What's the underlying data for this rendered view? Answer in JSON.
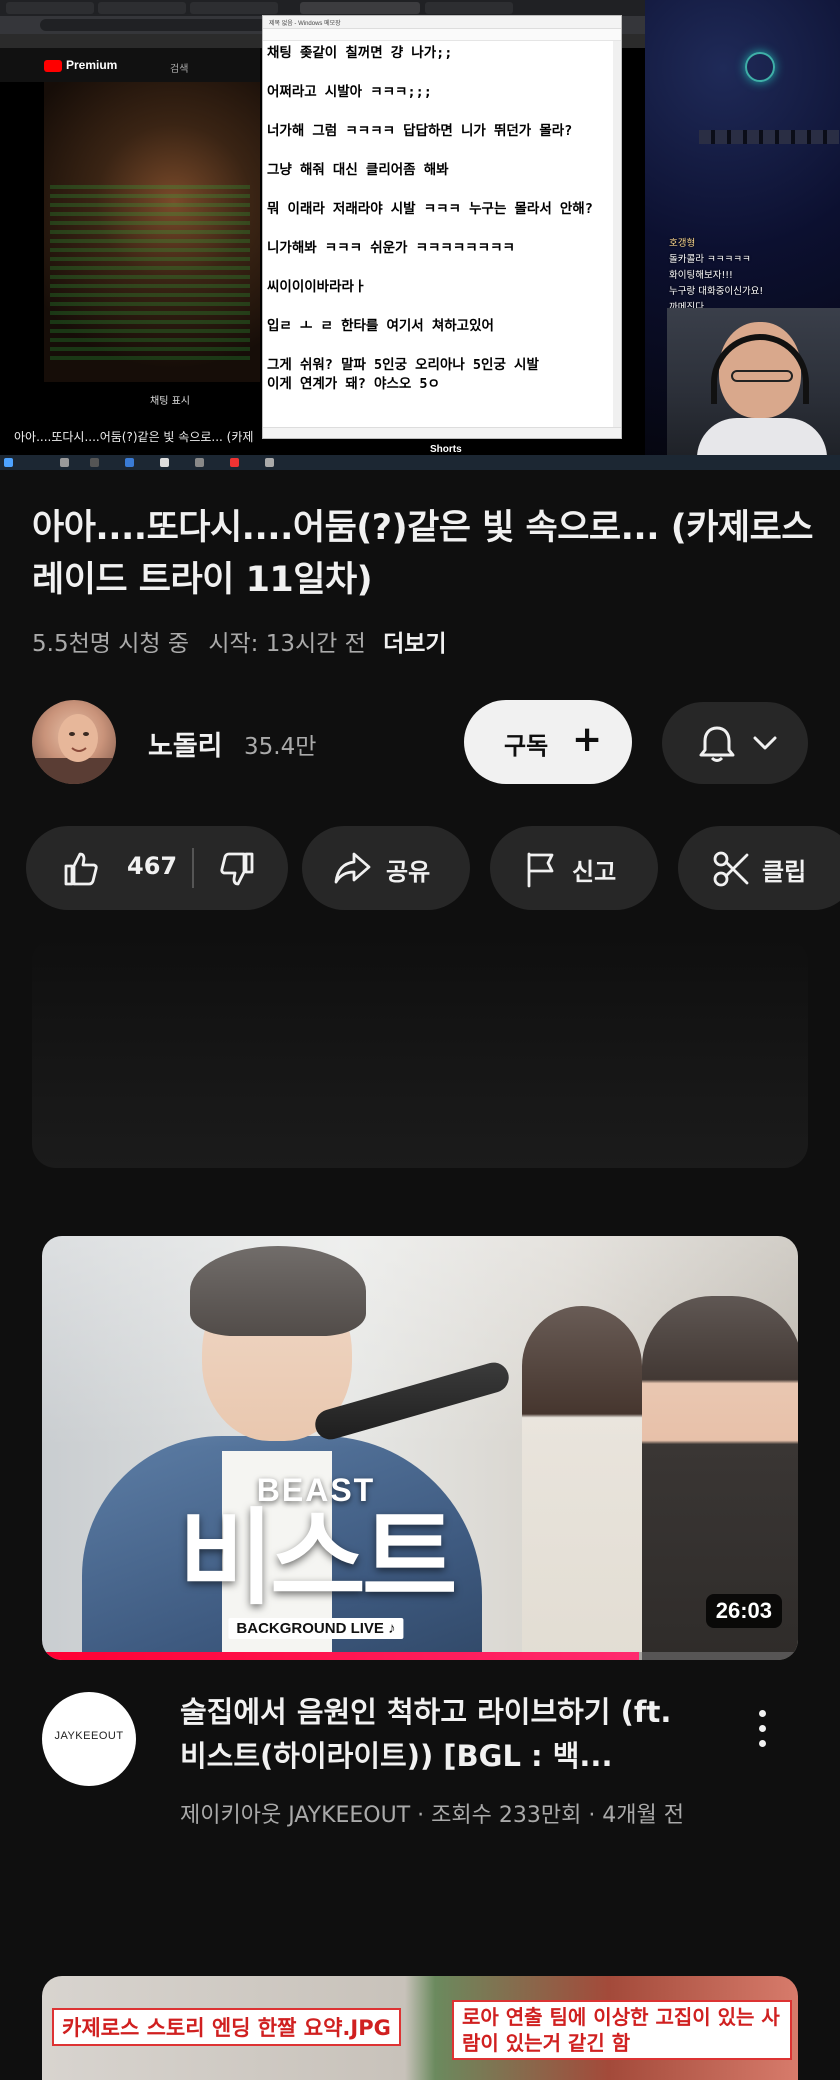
{
  "stream": {
    "notepad_title": "제목 없음 - Windows 메모장",
    "chat_lines": [
      "채팅 좆같이 칠꺼면 걍 나가;;",
      "어쩌라고 시발아 ㅋㅋㅋ;;;",
      "너가해 그럼 ㅋㅋㅋㅋ 답답하면 니가 뛰던가 몰라?",
      "그냥 해줘 대신 클리어좀 해봐",
      "뭐 이래라 저래라야 시발 ㅋㅋㅋ 누구는 몰라서 안해?",
      "니가해봐 ㅋㅋㅋ 쉬운가 ㅋㅋㅋㅋㅋㅋㅋㅋ",
      "씨이이이바라라ㅏ",
      "입ㄹ ㅗ ㄹ 한타를 여기서 쳐하고있어",
      "그게 쉬워? 말파 5인궁 오리아나 5인궁 시발",
      "이게 연계가 돼? 야스오 5ㅇ"
    ],
    "overlay_chat": [
      "호갱형",
      "돌카콜라 ㅋㅋㅋㅋㅋ",
      "화이팅해보자!!!",
      "누구랑 대화중이신가요!",
      "까메진다"
    ],
    "yt_logo_text": "Premium",
    "yt_search": "검색",
    "chat_toggle": "채팅 표시",
    "stream_strip_title": "아아....또다시....어둠(?)같은 빛 속으로... (카제로...",
    "shorts_label": "Shorts"
  },
  "video": {
    "title": "아아....또다시....어둠(?)같은 빛 속으로... (카제로스 레이드 트라이 11일차)",
    "views": "5.5천명 시청 중",
    "started": "시작: 13시간 전",
    "more": "더보기"
  },
  "channel": {
    "name": "노돌리",
    "subscribers": "35.4만",
    "subscribe_label": "구독",
    "subscribe_plus": "+"
  },
  "actions": {
    "like_count": "467",
    "share": "공유",
    "report": "신고",
    "clip": "클립"
  },
  "recommended": [
    {
      "title": "술집에서 음원인 척하고 라이브하기 (ft. 비스트(하이라이트)) [BGL : 백...",
      "meta": "제이키아웃 JAYKEEOUT · 조회수 233만회 · 4개월 전",
      "duration": "26:03",
      "channel_avatar_text": "JAYKEEOUT",
      "thumb_beast": "BEAST",
      "thumb_big": "비스트",
      "thumb_bgl": "BACKGROUND LIVE ♪",
      "watched_fraction": 0.79
    },
    {
      "thumb_caption_left": "카제로스 스토리 엔딩 한짤 요약.JPG",
      "thumb_caption_right": "로아 연출 팀에 이상한 고집이 있는 사람이 있는거 같긴 함"
    }
  ],
  "colors": {
    "background": "#0f0f0f",
    "pill": "#272727",
    "text_primary": "#f1f1f1",
    "text_secondary": "#aaaaaa",
    "progress": "#ff0033"
  }
}
